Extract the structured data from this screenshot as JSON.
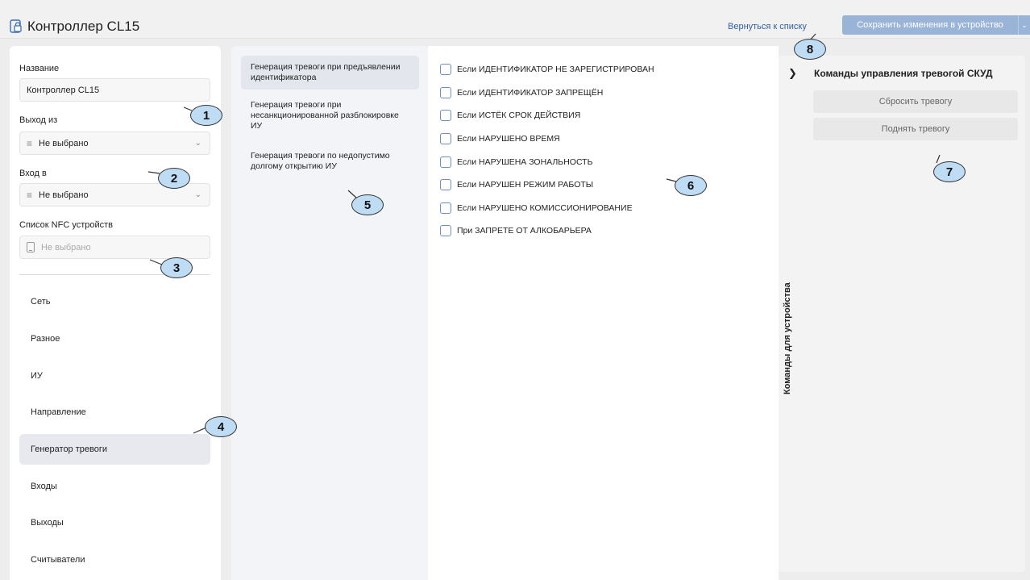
{
  "header": {
    "title": "Контроллер CL15",
    "back_link": "Вернуться к списку",
    "save_button": "Сохранить изменения в устройство",
    "lock_icon": "lock-icon",
    "dropdown_icon": "chevron-down-icon"
  },
  "form": {
    "name_label": "Название",
    "name_value": "Контроллер CL15",
    "exit_label": "Выход из",
    "exit_value": "Не выбрано",
    "entry_label": "Вход в",
    "entry_value": "Не выбрано",
    "nfc_label": "Список NFC устройств",
    "nfc_placeholder": "Не выбрано"
  },
  "nav": {
    "items": [
      "Сеть",
      "Разное",
      "ИУ",
      "Направление",
      "Генератор тревоги",
      "Входы",
      "Выходы",
      "Считыватели"
    ],
    "active": "Генератор тревоги"
  },
  "tabs": [
    "Генерация тревоги при предъявлении идентификатора",
    "Генерация тревоги при несанкционированной разблокировке ИУ",
    "Генерация тревоги по недопустимо долгому открытию ИУ"
  ],
  "options": [
    "Если ИДЕНТИФИКАТОР НЕ ЗАРЕГИСТРИРОВАН",
    "Если ИДЕНТИФИКАТОР ЗАПРЕЩЁН",
    "Если ИСТЁК СРОК ДЕЙСТВИЯ",
    "Если НАРУШЕНО ВРЕМЯ",
    "Если НАРУШЕНА ЗОНАЛЬНОСТЬ",
    "Если НАРУШЕН РЕЖИМ РАБОТЫ",
    "Если НАРУШЕНО КОМИССИОНИРОВАНИЕ",
    "При ЗАПРЕТЕ ОТ АЛКОБАРЬЕРА"
  ],
  "commands": {
    "panel_label": "Команды для устройства",
    "section_title": "Команды управления тревогой СКУД",
    "reset_button": "Сбросить тревогу",
    "raise_button": "Поднять тревогу"
  },
  "callouts": [
    "1",
    "2",
    "3",
    "4",
    "5",
    "6",
    "7",
    "8"
  ],
  "colors": {
    "accent": "#9ab4d8",
    "link": "#2f5ea8",
    "callout_fill": "#bfdcf5",
    "checkbox_border": "#6e8fc1"
  }
}
